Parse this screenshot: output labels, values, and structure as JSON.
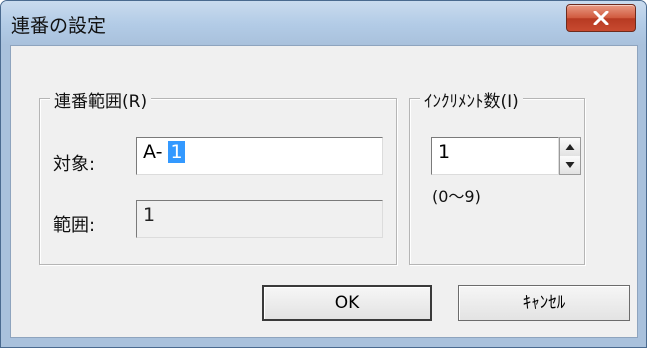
{
  "window": {
    "title": "連番の設定"
  },
  "sequence_group": {
    "label": "連番範囲(R)",
    "target_label": "対象:",
    "target_prefix": "A- ",
    "target_selected": "1",
    "range_label": "範囲:",
    "range_value": "1"
  },
  "increment_group": {
    "label": "ｲﾝｸﾘﾒﾝﾄ数(I)",
    "value": "1",
    "range_hint": "(0〜9)"
  },
  "buttons": {
    "ok": "OK",
    "cancel": "ｷｬﾝｾﾙ"
  }
}
